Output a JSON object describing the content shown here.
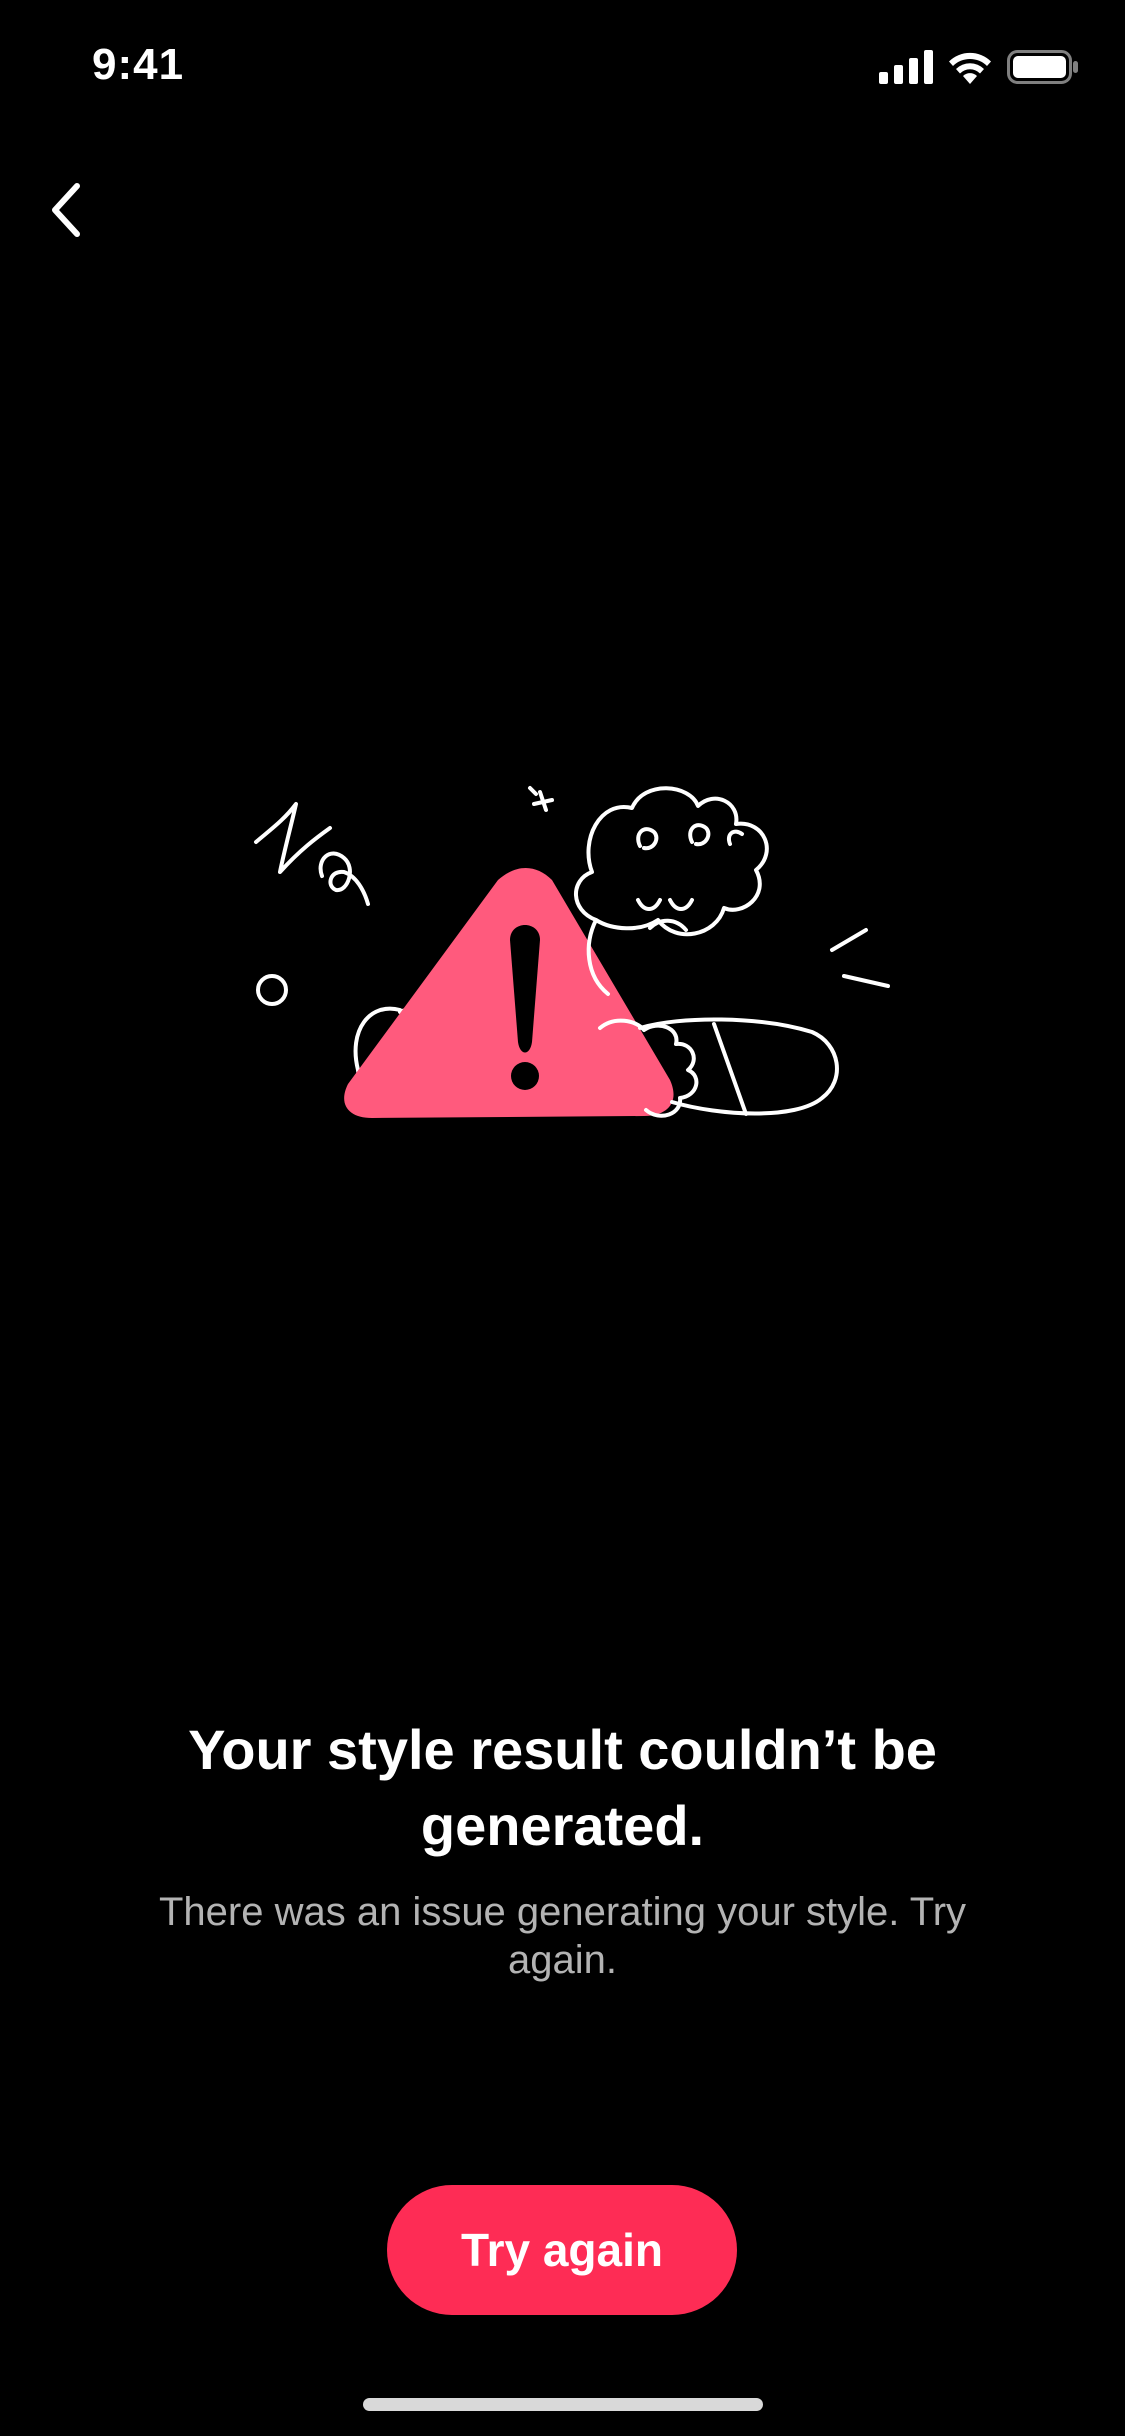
{
  "status_bar": {
    "time": "9:41",
    "icons": [
      "cellular-signal-icon",
      "wifi-icon",
      "battery-icon"
    ]
  },
  "nav": {
    "back_icon": "chevron-left-icon"
  },
  "illustration": {
    "icon": "warning-triangle-illustration",
    "accent_color": "#ff5a7d"
  },
  "message": {
    "title": "Your style result couldn’t be generated.",
    "subtitle": "There was an issue generating your style. Try again."
  },
  "actions": {
    "try_again_label": "Try again",
    "button_color": "#fe2c55"
  }
}
